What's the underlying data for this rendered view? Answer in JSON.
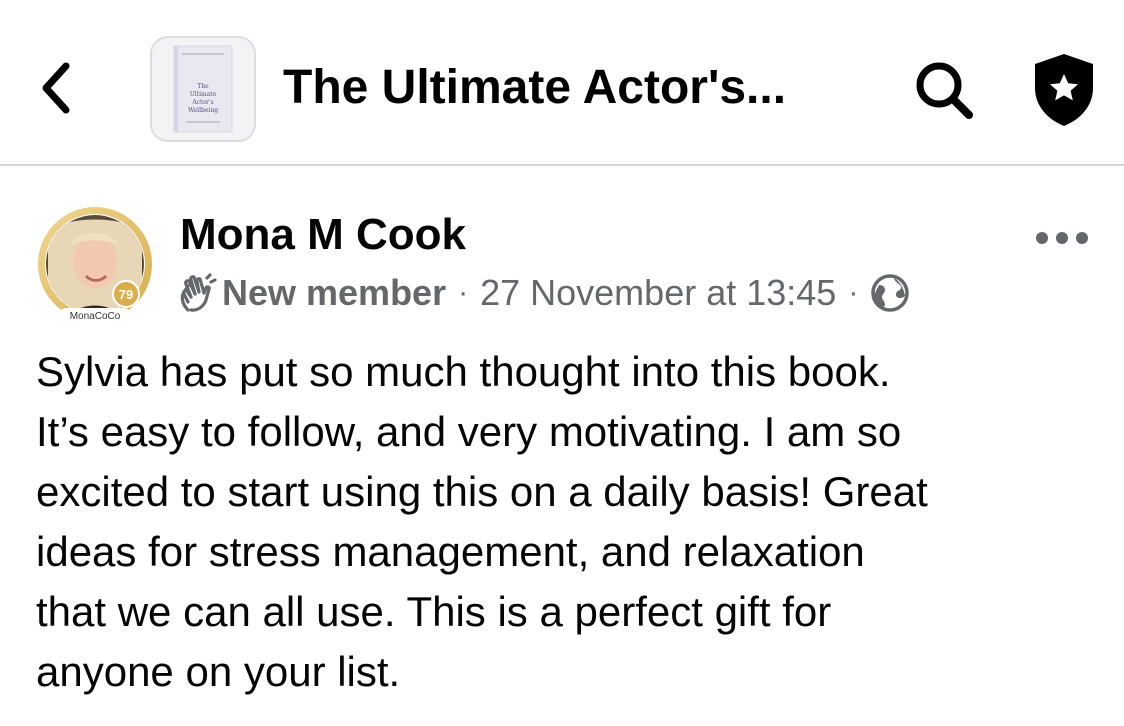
{
  "header": {
    "back_icon": "chevron-left-icon",
    "group_thumbnail_text": [
      "The",
      "Ultimate",
      "Actor's",
      "Wellbeing"
    ],
    "title": "The Ultimate Actor's...",
    "search_icon": "search-icon",
    "admin_icon": "shield-star-icon"
  },
  "post": {
    "author": "Mona M Cook",
    "avatar_caption": "MonaCoCo",
    "avatar_badge": "79",
    "member_badge_icon": "waving-hand-icon",
    "member_badge": "New member",
    "separator": "·",
    "timestamp": "27 November at 13:45",
    "privacy_icon": "globe-icon",
    "more_icon": "more-horizontal-icon",
    "lines": [
      "Sylvia has put so much thought into this book.",
      "It’s easy to follow, and very motivating. I am so",
      "excited to start using this on a daily basis! Great",
      "ideas for stress management, and relaxation",
      "that we can all use. This is a perfect gift for",
      "anyone on your list."
    ]
  },
  "colors": {
    "text_primary": "#050505",
    "text_secondary": "#65676b",
    "divider": "#d4d4d4",
    "avatar_ring": "#e6c36a"
  }
}
